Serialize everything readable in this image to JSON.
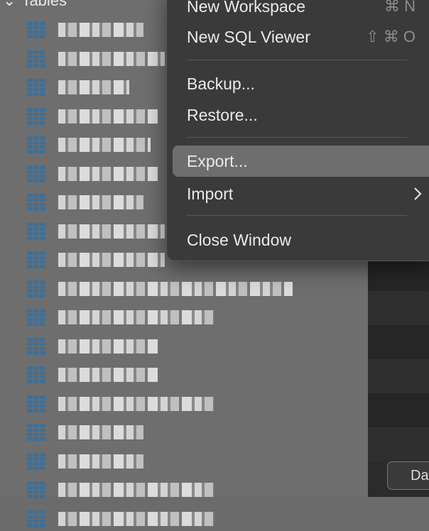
{
  "sidebar": {
    "header": "Tables",
    "table_count": 18
  },
  "menu": {
    "items": [
      {
        "label": "New Workspace",
        "shortcut": "⌘ N"
      },
      {
        "label": "New SQL Viewer",
        "shortcut": "⇧ ⌘ O"
      },
      {
        "label": "Backup..."
      },
      {
        "label": "Restore..."
      },
      {
        "label": "Export..."
      },
      {
        "label": "Import"
      },
      {
        "label": "Close Window"
      }
    ]
  },
  "right_panel": {
    "button_label": "Da"
  },
  "colors": {
    "menu_bg": "#3a3a3a",
    "highlight": "#6e6e6e",
    "table_icon": "#3f6f96"
  },
  "icons": {
    "table": "table-grid-icon",
    "chevron": "chevron-down-icon",
    "submenu": "chevron-right-icon"
  }
}
